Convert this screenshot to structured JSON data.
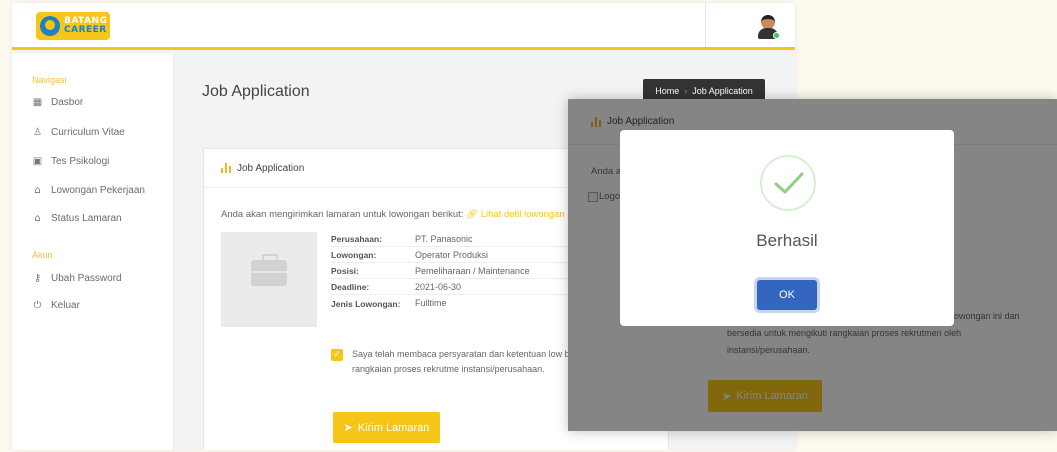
{
  "header": {
    "logo_line1": "BATANG",
    "logo_line2": "CAREER"
  },
  "sidebar": {
    "section_nav": "Navigasi",
    "items_nav": [
      {
        "label": "Dasbor",
        "icon": "dashboard-icon"
      },
      {
        "label": "Curriculum Vitae",
        "icon": "user-icon"
      },
      {
        "label": "Tes Psikologi",
        "icon": "image-icon"
      },
      {
        "label": "Lowongan Pekerjaan",
        "icon": "building-icon"
      },
      {
        "label": "Status Lamaran",
        "icon": "building-icon"
      }
    ],
    "section_account": "Akun",
    "items_account": [
      {
        "label": "Ubah Password",
        "icon": "key-icon"
      },
      {
        "label": "Keluar",
        "icon": "power-icon"
      }
    ]
  },
  "page": {
    "title": "Job Application",
    "breadcrumb": {
      "home": "Home",
      "separator": "›",
      "current": "Job Application"
    }
  },
  "card": {
    "title": "Job Application",
    "intro": "Anda akan mengirimkan lamaran untuk lowongan berikut:",
    "link": "Lihat detil lowongan",
    "details": [
      {
        "key": "Perusahaan:",
        "value": "PT. Panasonic"
      },
      {
        "key": "Lowongan:",
        "value": "Operator Produksi"
      },
      {
        "key": "Posisi:",
        "value": "Pemeliharaan / Maintenance"
      },
      {
        "key": "Deadline:",
        "value": "2021-06-30"
      },
      {
        "key": "Jenis Lowongan:",
        "value": "Fulltime"
      }
    ],
    "agreement": "Saya telah membaca persyaratan dan ketentuan low bersedia untuk mengikuti rangkaian proses rekrutme instansi/perusahaan.",
    "submit": "Kirim Lamaran"
  },
  "front": {
    "title": "Job Application",
    "intro": "Anda a",
    "logo_alt": "Logo",
    "agreement_line1": "owongan ini dan",
    "agreement_line2": "bersedia untuk mengikuti rangkaian proses rekrutmen oleh",
    "agreement_line3": "instansi/perusahaan.",
    "submit": "Kirim Lamaran"
  },
  "modal": {
    "title": "Berhasil",
    "ok": "OK",
    "icon": "success-check-icon"
  },
  "colors": {
    "accent": "#f5c518",
    "brand_blue": "#1f7fc7",
    "ok_button": "#3466c0",
    "success": "#8bd17c"
  }
}
